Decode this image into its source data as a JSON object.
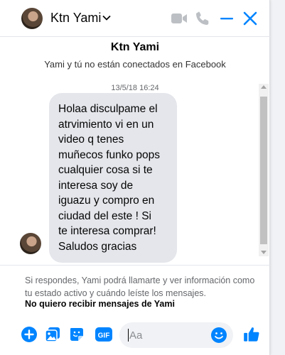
{
  "header": {
    "contact_name": "Ktn Yami"
  },
  "conversation": {
    "title": "Ktn Yami",
    "subtitle": "Yami y tú no están conectados en Facebook",
    "timestamp": "13/5/18 16:24",
    "message": "Holaa disculpame el\natrvimiento vi en un\nvideo q tenes\nmuñecos funko pops\ncualquier cosa si te\ninteresa  soy de\niguazu y compro en\nciudad del este ! Si\nte interesa comprar!\nSaludos gracias"
  },
  "notice": {
    "text": "Si respondes, Yami podrá llamarte y ver información como tu estado activo y cuándo leíste los mensajes.",
    "link": "No quiero recibir mensajes de Yami"
  },
  "composer": {
    "placeholder": "Aa",
    "gif_label": "GIF"
  },
  "colors": {
    "accent": "#0084ff",
    "bubble": "#e4e6eb",
    "disabled_icon": "#bcc0c4"
  }
}
